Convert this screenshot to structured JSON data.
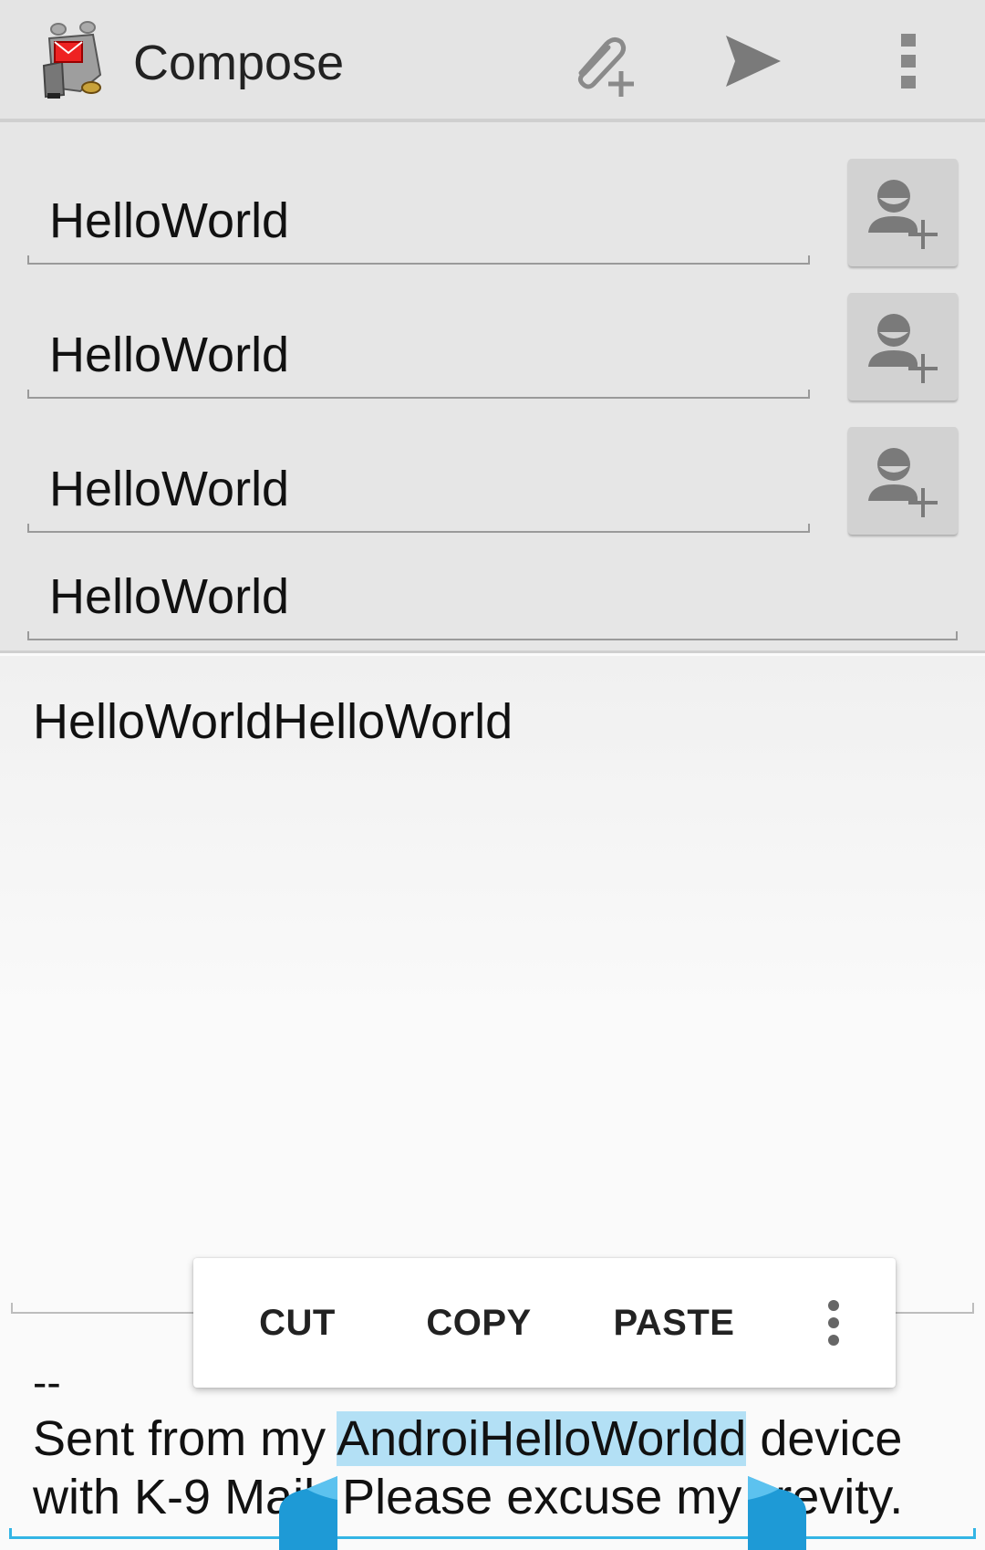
{
  "action_bar": {
    "title": "Compose",
    "icons": [
      "k9-mail-app-icon",
      "attach-icon",
      "send-icon",
      "overflow-menu-icon"
    ]
  },
  "header": {
    "to_field": "HelloWorld",
    "cc_field": "HelloWorld",
    "bcc_field": "HelloWorld",
    "subject_field": "HelloWorld"
  },
  "body": {
    "text": "HelloWorldHelloWorld"
  },
  "signature": {
    "dash": "--",
    "line1_before": "Sent from my ",
    "line1_selected": "AndroiHelloWorldd",
    "line1_after": " device",
    "line2_part1": "with K-9 Mail",
    "line2_part2": "Please excuse my ",
    "line2_part3": "revity."
  },
  "selection_toolbar": {
    "cut": "CUT",
    "copy": "COPY",
    "paste": "PASTE"
  },
  "colors": {
    "accent": "#33b5e5",
    "selection": "#b3e0f5",
    "handle": "#1e9ad6",
    "header_bg": "#e6e6e6"
  }
}
